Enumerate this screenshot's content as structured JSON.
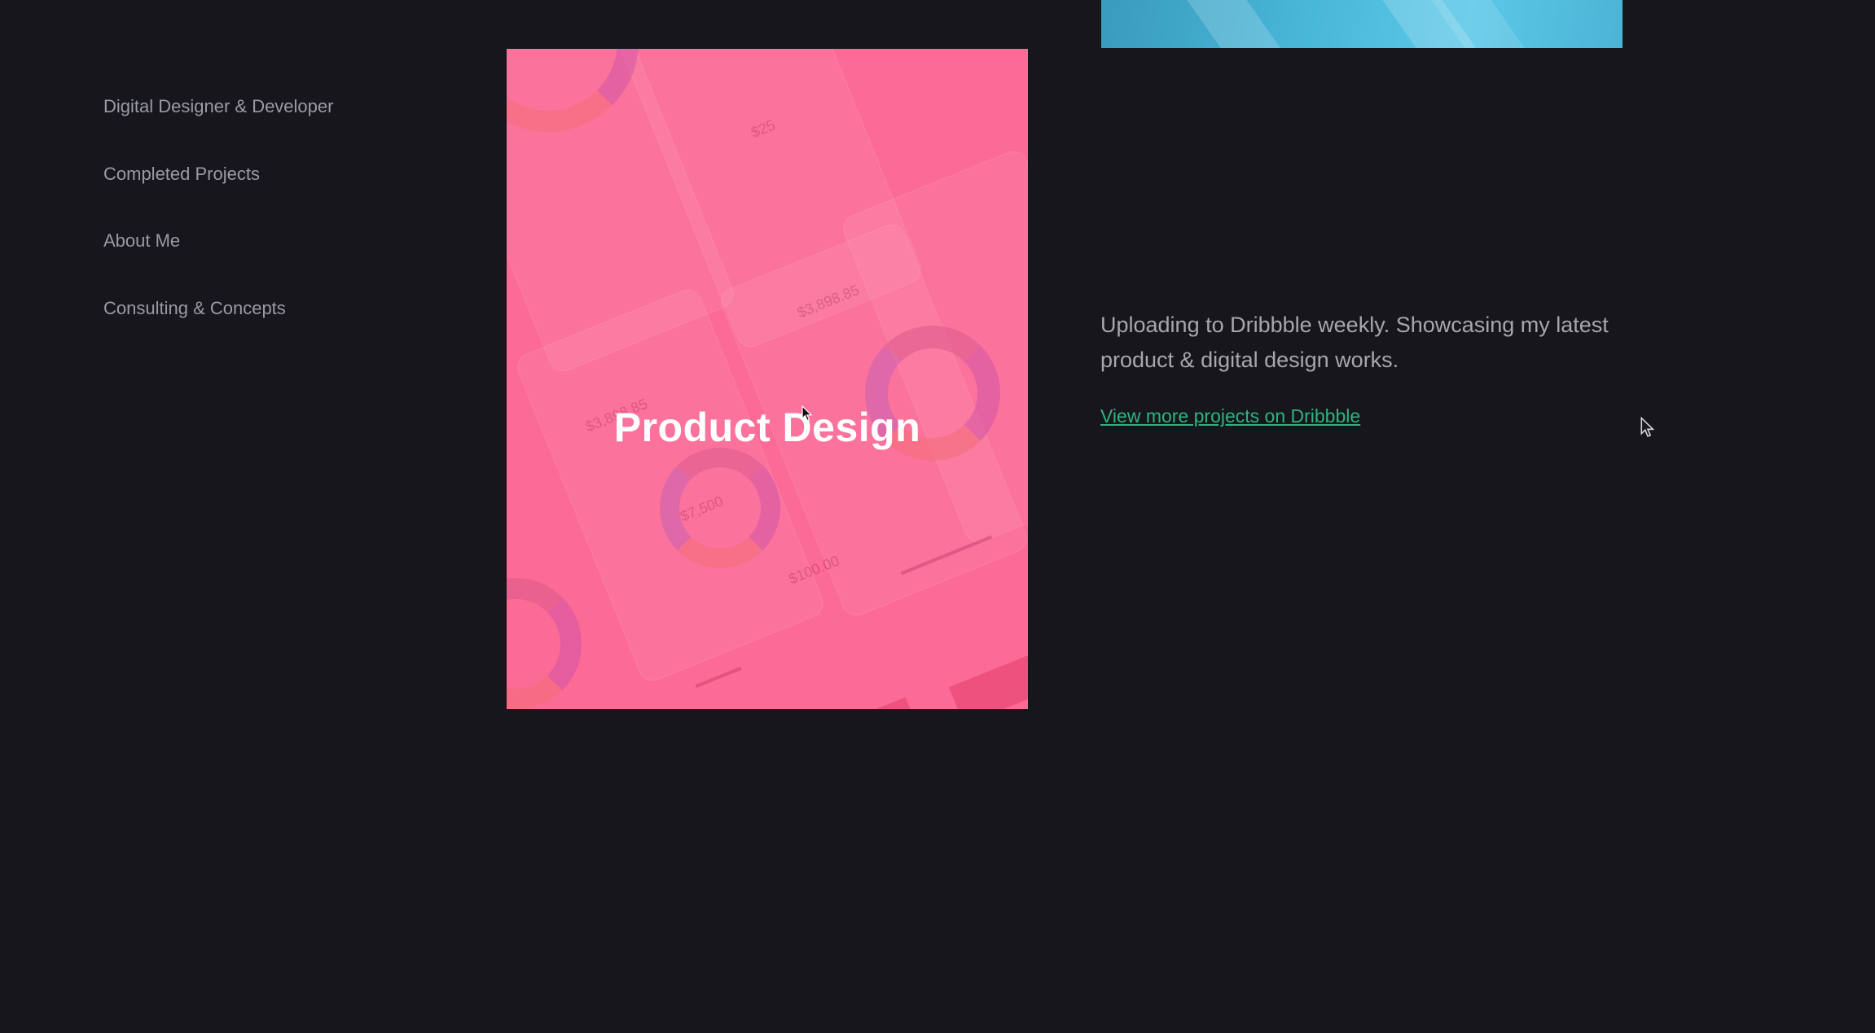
{
  "sidebar": {
    "items": [
      {
        "label": "Digital Designer & Developer"
      },
      {
        "label": "Completed Projects"
      },
      {
        "label": "About Me"
      },
      {
        "label": "Consulting & Concepts"
      }
    ]
  },
  "product_card": {
    "title": "Product Design",
    "background_color": "#fb6b96",
    "ghost_values": [
      "$3,898.85",
      "$3,898.85",
      "$7,500",
      "$100.00",
      "$25"
    ]
  },
  "top_card": {
    "color": "#48b7d8"
  },
  "info": {
    "description": "Uploading to Dribbble weekly. Showcasing my latest product & digital design works.",
    "link_label": "View more projects on Dribbble",
    "link_color": "#2fb37e"
  },
  "icons": [
    "cursor-arrow-icon",
    "cursor-pointer-icon"
  ]
}
